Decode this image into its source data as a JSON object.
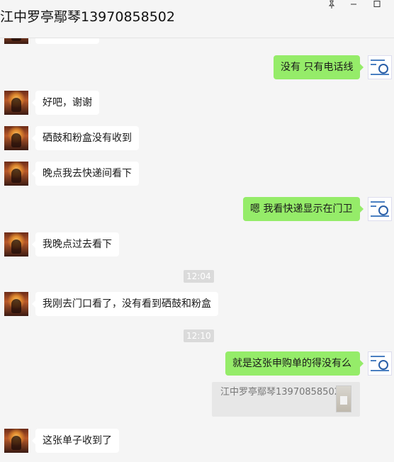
{
  "window": {
    "title": "江中罗亭鄢琴13970858502",
    "pin_icon": "pin-icon",
    "minimize_icon": "minimize-icon",
    "maximize_icon": "maximize-icon"
  },
  "messages": [
    {
      "side": "out",
      "text": "没有 只有电话线"
    },
    {
      "side": "in",
      "text": "好吧，谢谢"
    },
    {
      "side": "in",
      "text": "硒鼓和粉盒没有收到"
    },
    {
      "side": "in",
      "text": "晚点我去快递间看下"
    },
    {
      "side": "out",
      "text": "嗯 我看快递显示在门卫"
    },
    {
      "side": "in",
      "text": "我晚点过去看下"
    },
    {
      "side": "time",
      "text": "12:04"
    },
    {
      "side": "in",
      "text": "我刚去门口看了，没有看到硒鼓和粉盒"
    },
    {
      "side": "time",
      "text": "12:10"
    },
    {
      "side": "out",
      "text": "就是这张申购单的得没有么"
    },
    {
      "side": "quote",
      "text": "江中罗亭鄢琴13970858502："
    },
    {
      "side": "in",
      "text": "这张单子收到了"
    }
  ],
  "colors": {
    "background": "#f5f5f5",
    "incoming_bubble": "#ffffff",
    "outgoing_bubble": "#95ec69",
    "timestamp_bg": "#dadada"
  }
}
